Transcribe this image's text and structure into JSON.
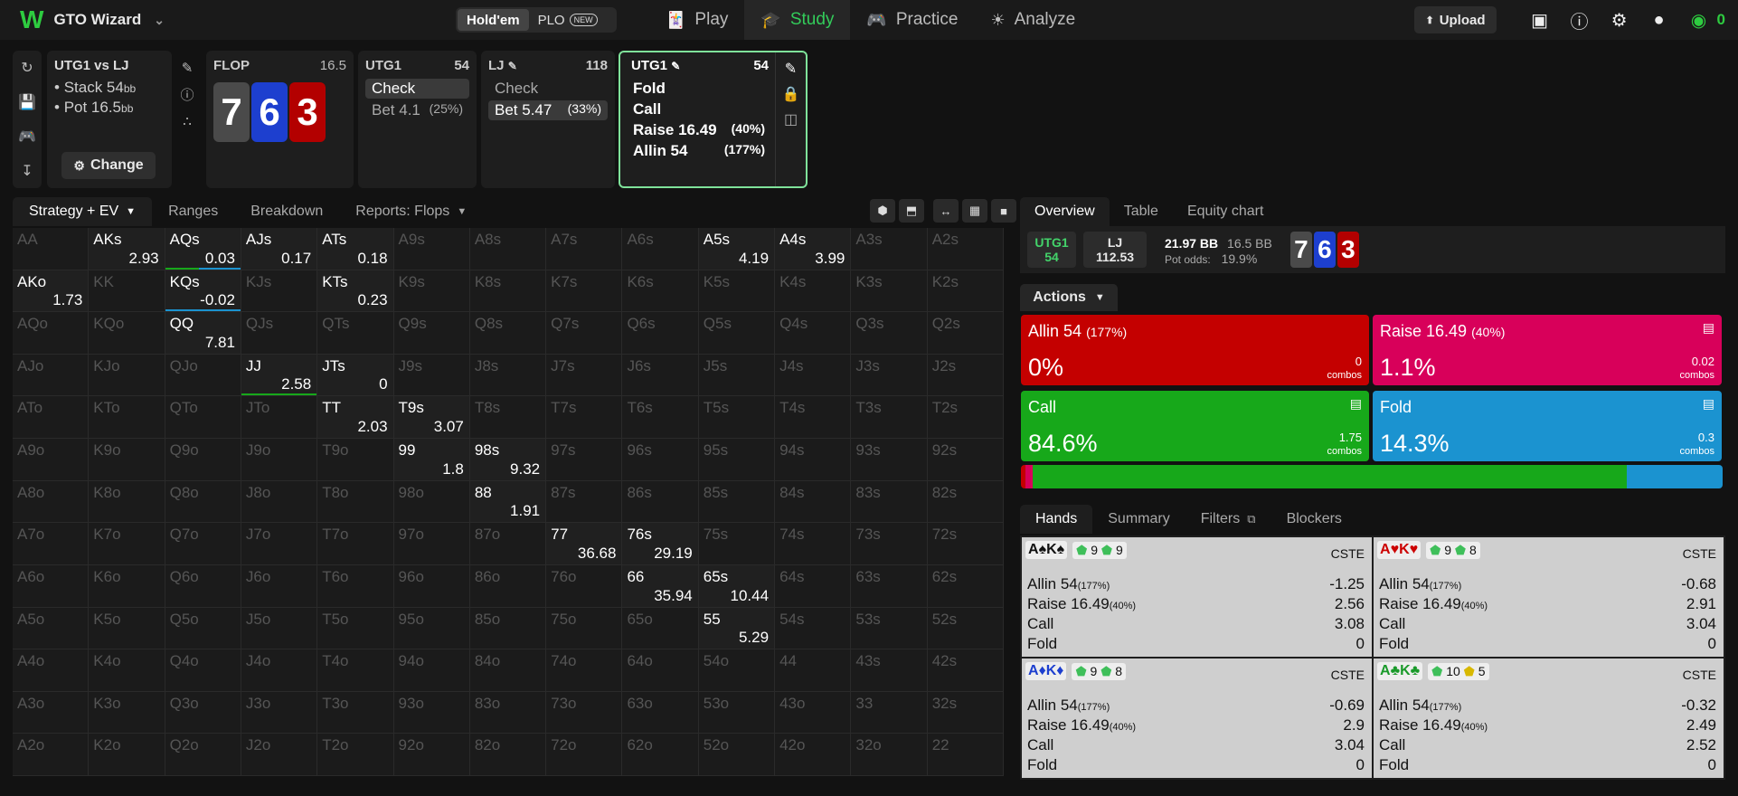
{
  "app": {
    "title": "GTO Wizard",
    "coins": "0"
  },
  "game_toggle": {
    "holdem": "Hold'em",
    "plo": "PLO",
    "new_badge": "NEW"
  },
  "nav": [
    {
      "label": "Play",
      "icon": "cards-icon"
    },
    {
      "label": "Study",
      "icon": "graduation-icon"
    },
    {
      "label": "Practice",
      "icon": "gamepad-icon"
    },
    {
      "label": "Analyze",
      "icon": "bulb-icon"
    }
  ],
  "upload_label": "Upload",
  "spot": {
    "title": "UTG1 vs LJ",
    "stack_label": "Stack 54",
    "stack_unit": "bb",
    "pot_label": "Pot 16.5",
    "pot_unit": "bb",
    "change_label": "Change"
  },
  "flop": {
    "label": "FLOP",
    "pot": "16.5",
    "cards": [
      "7",
      "6",
      "3"
    ]
  },
  "action_cards": [
    {
      "player": "UTG1",
      "stack": "54",
      "options": [
        {
          "label": "Check",
          "pct": "",
          "selected": true
        },
        {
          "label": "Bet 4.1",
          "pct": "(25%)",
          "selected": false
        }
      ]
    },
    {
      "player": "LJ",
      "stack": "118",
      "options": [
        {
          "label": "Check",
          "pct": "",
          "selected": false
        },
        {
          "label": "Bet 5.47",
          "pct": "(33%)",
          "selected": true
        }
      ]
    }
  ],
  "current": {
    "player": "UTG1",
    "stack": "54",
    "options": [
      {
        "label": "Fold",
        "pct": ""
      },
      {
        "label": "Call",
        "pct": ""
      },
      {
        "label": "Raise 16.49",
        "pct": "(40%)"
      },
      {
        "label": "Allin 54",
        "pct": "(177%)"
      }
    ]
  },
  "left_tabs": [
    "Strategy + EV",
    "Ranges",
    "Breakdown",
    "Reports: Flops"
  ],
  "matrix": [
    [
      [
        "AA",
        ""
      ],
      [
        "AKs",
        "2.93"
      ],
      [
        "AQs",
        "0.03"
      ],
      [
        "AJs",
        "0.17"
      ],
      [
        "ATs",
        "0.18"
      ],
      [
        "A9s",
        ""
      ],
      [
        "A8s",
        ""
      ],
      [
        "A7s",
        ""
      ],
      [
        "A6s",
        ""
      ],
      [
        "A5s",
        "4.19"
      ],
      [
        "A4s",
        "3.99"
      ],
      [
        "A3s",
        ""
      ],
      [
        "A2s",
        ""
      ]
    ],
    [
      [
        "AKo",
        "1.73"
      ],
      [
        "KK",
        ""
      ],
      [
        "KQs",
        "-0.02"
      ],
      [
        "KJs",
        ""
      ],
      [
        "KTs",
        "0.23"
      ],
      [
        "K9s",
        ""
      ],
      [
        "K8s",
        ""
      ],
      [
        "K7s",
        ""
      ],
      [
        "K6s",
        ""
      ],
      [
        "K5s",
        ""
      ],
      [
        "K4s",
        ""
      ],
      [
        "K3s",
        ""
      ],
      [
        "K2s",
        ""
      ]
    ],
    [
      [
        "AQo",
        ""
      ],
      [
        "KQo",
        ""
      ],
      [
        "QQ",
        "7.81"
      ],
      [
        "QJs",
        ""
      ],
      [
        "QTs",
        ""
      ],
      [
        "Q9s",
        ""
      ],
      [
        "Q8s",
        ""
      ],
      [
        "Q7s",
        ""
      ],
      [
        "Q6s",
        ""
      ],
      [
        "Q5s",
        ""
      ],
      [
        "Q4s",
        ""
      ],
      [
        "Q3s",
        ""
      ],
      [
        "Q2s",
        ""
      ]
    ],
    [
      [
        "AJo",
        ""
      ],
      [
        "KJo",
        ""
      ],
      [
        "QJo",
        ""
      ],
      [
        "JJ",
        "2.58"
      ],
      [
        "JTs",
        "0"
      ],
      [
        "J9s",
        ""
      ],
      [
        "J8s",
        ""
      ],
      [
        "J7s",
        ""
      ],
      [
        "J6s",
        ""
      ],
      [
        "J5s",
        ""
      ],
      [
        "J4s",
        ""
      ],
      [
        "J3s",
        ""
      ],
      [
        "J2s",
        ""
      ]
    ],
    [
      [
        "ATo",
        ""
      ],
      [
        "KTo",
        ""
      ],
      [
        "QTo",
        ""
      ],
      [
        "JTo",
        ""
      ],
      [
        "TT",
        "2.03"
      ],
      [
        "T9s",
        "3.07"
      ],
      [
        "T8s",
        ""
      ],
      [
        "T7s",
        ""
      ],
      [
        "T6s",
        ""
      ],
      [
        "T5s",
        ""
      ],
      [
        "T4s",
        ""
      ],
      [
        "T3s",
        ""
      ],
      [
        "T2s",
        ""
      ]
    ],
    [
      [
        "A9o",
        ""
      ],
      [
        "K9o",
        ""
      ],
      [
        "Q9o",
        ""
      ],
      [
        "J9o",
        ""
      ],
      [
        "T9o",
        ""
      ],
      [
        "99",
        "1.8"
      ],
      [
        "98s",
        "9.32"
      ],
      [
        "97s",
        ""
      ],
      [
        "96s",
        ""
      ],
      [
        "95s",
        ""
      ],
      [
        "94s",
        ""
      ],
      [
        "93s",
        ""
      ],
      [
        "92s",
        ""
      ]
    ],
    [
      [
        "A8o",
        ""
      ],
      [
        "K8o",
        ""
      ],
      [
        "Q8o",
        ""
      ],
      [
        "J8o",
        ""
      ],
      [
        "T8o",
        ""
      ],
      [
        "98o",
        ""
      ],
      [
        "88",
        "1.91"
      ],
      [
        "87s",
        ""
      ],
      [
        "86s",
        ""
      ],
      [
        "85s",
        ""
      ],
      [
        "84s",
        ""
      ],
      [
        "83s",
        ""
      ],
      [
        "82s",
        ""
      ]
    ],
    [
      [
        "A7o",
        ""
      ],
      [
        "K7o",
        ""
      ],
      [
        "Q7o",
        ""
      ],
      [
        "J7o",
        ""
      ],
      [
        "T7o",
        ""
      ],
      [
        "97o",
        ""
      ],
      [
        "87o",
        ""
      ],
      [
        "77",
        "36.68"
      ],
      [
        "76s",
        "29.19"
      ],
      [
        "75s",
        ""
      ],
      [
        "74s",
        ""
      ],
      [
        "73s",
        ""
      ],
      [
        "72s",
        ""
      ]
    ],
    [
      [
        "A6o",
        ""
      ],
      [
        "K6o",
        ""
      ],
      [
        "Q6o",
        ""
      ],
      [
        "J6o",
        ""
      ],
      [
        "T6o",
        ""
      ],
      [
        "96o",
        ""
      ],
      [
        "86o",
        ""
      ],
      [
        "76o",
        ""
      ],
      [
        "66",
        "35.94"
      ],
      [
        "65s",
        "10.44"
      ],
      [
        "64s",
        ""
      ],
      [
        "63s",
        ""
      ],
      [
        "62s",
        ""
      ]
    ],
    [
      [
        "A5o",
        ""
      ],
      [
        "K5o",
        ""
      ],
      [
        "Q5o",
        ""
      ],
      [
        "J5o",
        ""
      ],
      [
        "T5o",
        ""
      ],
      [
        "95o",
        ""
      ],
      [
        "85o",
        ""
      ],
      [
        "75o",
        ""
      ],
      [
        "65o",
        ""
      ],
      [
        "55",
        "5.29"
      ],
      [
        "54s",
        ""
      ],
      [
        "53s",
        ""
      ],
      [
        "52s",
        ""
      ]
    ],
    [
      [
        "A4o",
        ""
      ],
      [
        "K4o",
        ""
      ],
      [
        "Q4o",
        ""
      ],
      [
        "J4o",
        ""
      ],
      [
        "T4o",
        ""
      ],
      [
        "94o",
        ""
      ],
      [
        "84o",
        ""
      ],
      [
        "74o",
        ""
      ],
      [
        "64o",
        ""
      ],
      [
        "54o",
        ""
      ],
      [
        "44",
        ""
      ],
      [
        "43s",
        ""
      ],
      [
        "42s",
        ""
      ]
    ],
    [
      [
        "A3o",
        ""
      ],
      [
        "K3o",
        ""
      ],
      [
        "Q3o",
        ""
      ],
      [
        "J3o",
        ""
      ],
      [
        "T3o",
        ""
      ],
      [
        "93o",
        ""
      ],
      [
        "83o",
        ""
      ],
      [
        "73o",
        ""
      ],
      [
        "63o",
        ""
      ],
      [
        "53o",
        ""
      ],
      [
        "43o",
        ""
      ],
      [
        "33",
        ""
      ],
      [
        "32s",
        ""
      ]
    ],
    [
      [
        "A2o",
        ""
      ],
      [
        "K2o",
        ""
      ],
      [
        "Q2o",
        ""
      ],
      [
        "J2o",
        ""
      ],
      [
        "T2o",
        ""
      ],
      [
        "92o",
        ""
      ],
      [
        "82o",
        ""
      ],
      [
        "72o",
        ""
      ],
      [
        "62o",
        ""
      ],
      [
        "52o",
        ""
      ],
      [
        "42o",
        ""
      ],
      [
        "32o",
        ""
      ],
      [
        "22",
        ""
      ]
    ]
  ],
  "right_tabs": [
    "Overview",
    "Table",
    "Equity chart"
  ],
  "overview": {
    "p1": "UTG1",
    "p1_stack": "54",
    "p2": "LJ",
    "p2_stack": "112.53",
    "pot_bb": "21.97 BB",
    "bet_bb": "16.5 BB",
    "pot_odds_label": "Pot odds:",
    "pot_odds": "19.9%"
  },
  "actions_label": "Actions",
  "actions": [
    {
      "name": "Allin 54",
      "pct_note": "(177%)",
      "freq": "0%",
      "combos": "0",
      "combos_label": "combos",
      "color": "#c40000"
    },
    {
      "name": "Raise 16.49",
      "pct_note": "(40%)",
      "freq": "1.1%",
      "combos": "0.02",
      "combos_label": "combos",
      "color": "#d8005a"
    },
    {
      "name": "Call",
      "pct_note": "",
      "freq": "84.6%",
      "combos": "1.75",
      "combos_label": "combos",
      "color": "#17a81a"
    },
    {
      "name": "Fold",
      "pct_note": "",
      "freq": "14.3%",
      "combos": "0.3",
      "combos_label": "combos",
      "color": "#1b93d0"
    }
  ],
  "freq_bar": [
    {
      "value": 0.0,
      "color": "#c40000"
    },
    {
      "value": 1.1,
      "color": "#d8005a"
    },
    {
      "value": 84.6,
      "color": "#17a81a"
    },
    {
      "value": 14.3,
      "color": "#1b93d0"
    }
  ],
  "hand_tabs": [
    "Hands",
    "Summary",
    "Filters",
    "Blockers"
  ],
  "hands": [
    {
      "r1": "A",
      "s1": "♠",
      "r2": "K",
      "s2": "♠",
      "color": "",
      "eq": "9",
      "eq2": "9",
      "cste": "CSTE",
      "rows": [
        [
          "Allin 54",
          "(177%)",
          "-1.25"
        ],
        [
          "Raise 16.49",
          "(40%)",
          "2.56"
        ],
        [
          "Call",
          "",
          "3.08"
        ],
        [
          "Fold",
          "",
          "0"
        ]
      ]
    },
    {
      "r1": "A",
      "s1": "♥",
      "r2": "K",
      "s2": "♥",
      "color": "red",
      "eq": "9",
      "eq2": "8",
      "cste": "CSTE",
      "rows": [
        [
          "Allin 54",
          "(177%)",
          "-0.68"
        ],
        [
          "Raise 16.49",
          "(40%)",
          "2.91"
        ],
        [
          "Call",
          "",
          "3.04"
        ],
        [
          "Fold",
          "",
          "0"
        ]
      ]
    },
    {
      "r1": "A",
      "s1": "♦",
      "r2": "K",
      "s2": "♦",
      "color": "blu",
      "eq": "9",
      "eq2": "8",
      "cste": "CSTE",
      "rows": [
        [
          "Allin 54",
          "(177%)",
          "-0.69"
        ],
        [
          "Raise 16.49",
          "(40%)",
          "2.9"
        ],
        [
          "Call",
          "",
          "3.04"
        ],
        [
          "Fold",
          "",
          "0"
        ]
      ]
    },
    {
      "r1": "A",
      "s1": "♣",
      "r2": "K",
      "s2": "♣",
      "color": "grn",
      "eq": "10",
      "eq2": "5",
      "cste": "CSTE",
      "rows": [
        [
          "Allin 54",
          "(177%)",
          "-0.32"
        ],
        [
          "Raise 16.49",
          "(40%)",
          "2.49"
        ],
        [
          "Call",
          "",
          "2.52"
        ],
        [
          "Fold",
          "",
          "0"
        ]
      ]
    }
  ]
}
